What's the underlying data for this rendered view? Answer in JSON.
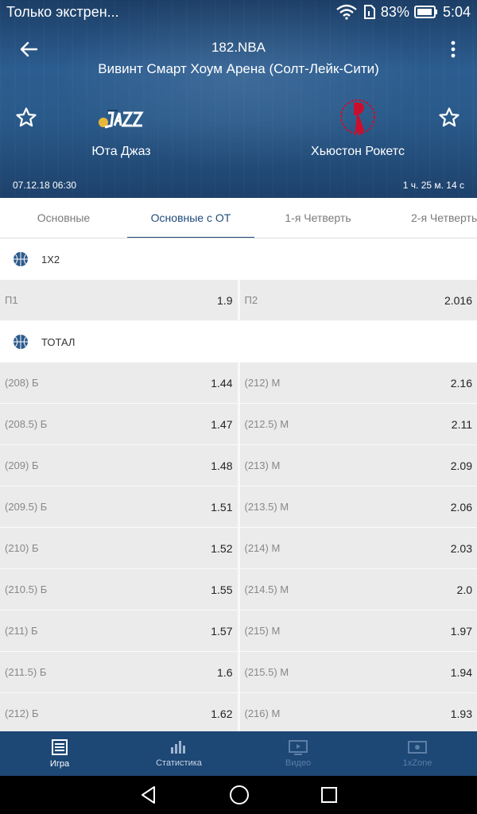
{
  "status_bar": {
    "notification": "Только экстрен...",
    "battery": "83%",
    "time": "5:04"
  },
  "header": {
    "league": "182.NBA",
    "venue": "Вивинт Смарт Хоум Арена (Солт-Лейк-Сити)",
    "home_team": "Юта Джаз",
    "away_team": "Хьюстон Рокетс",
    "date": "07.12.18 06:30",
    "elapsed": "1 ч. 25 м. 14 с",
    "icons": [
      "arrow-left-icon",
      "more-vert-icon",
      "star-outline-icon",
      "utah-jazz-logo",
      "houston-rockets-logo"
    ]
  },
  "tabs": [
    "Основные",
    "Основные с ОТ",
    "1-я  Четверть",
    "2-я Четверть"
  ],
  "groups": {
    "g1": {
      "title": "1X2",
      "rows": [
        {
          "l_label": "П1",
          "l_val": "1.9",
          "r_label": "П2",
          "r_val": "2.016"
        }
      ]
    },
    "g2": {
      "title": "ТОТАЛ",
      "rows": [
        {
          "l_label": "(208) Б",
          "l_val": "1.44",
          "r_label": "(212) М",
          "r_val": "2.16"
        },
        {
          "l_label": "(208.5) Б",
          "l_val": "1.47",
          "r_label": "(212.5) М",
          "r_val": "2.11"
        },
        {
          "l_label": "(209) Б",
          "l_val": "1.48",
          "r_label": "(213) М",
          "r_val": "2.09"
        },
        {
          "l_label": "(209.5) Б",
          "l_val": "1.51",
          "r_label": "(213.5) М",
          "r_val": "2.06"
        },
        {
          "l_label": "(210) Б",
          "l_val": "1.52",
          "r_label": "(214) М",
          "r_val": "2.03"
        },
        {
          "l_label": "(210.5) Б",
          "l_val": "1.55",
          "r_label": "(214.5) М",
          "r_val": "2.0"
        },
        {
          "l_label": "(211) Б",
          "l_val": "1.57",
          "r_label": "(215) М",
          "r_val": "1.97"
        },
        {
          "l_label": "(211.5) Б",
          "l_val": "1.6",
          "r_label": "(215.5) М",
          "r_val": "1.94"
        },
        {
          "l_label": "(212) Б",
          "l_val": "1.62",
          "r_label": "(216) М",
          "r_val": "1.93"
        }
      ]
    }
  },
  "bottom_nav": [
    {
      "label": "Игра",
      "icon": "game-list-icon"
    },
    {
      "label": "Статистика",
      "icon": "bar-chart-icon"
    },
    {
      "label": "Видео",
      "icon": "video-icon"
    },
    {
      "label": "1xZone",
      "icon": "zone-icon"
    }
  ],
  "colors": {
    "header": "#2a5a8a",
    "accent": "#1e4a7a",
    "nav": "#1d4775"
  }
}
